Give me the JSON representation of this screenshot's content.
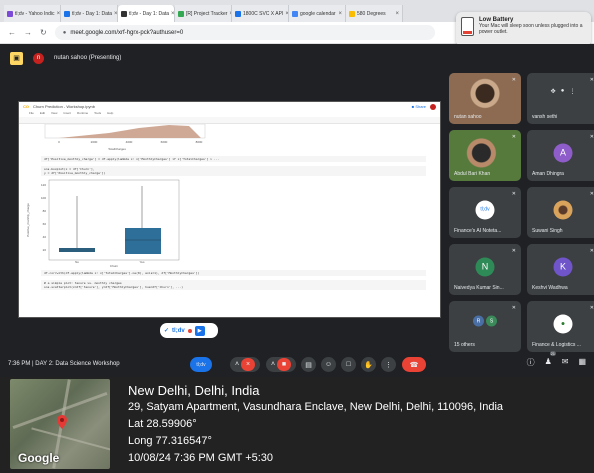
{
  "browser": {
    "tabs": [
      {
        "label": "tl;dv - Yahoo Indic",
        "color": "#7b4bd8"
      },
      {
        "label": "tl;dv - Day 1: Data",
        "color": "#1a73e8"
      },
      {
        "label": "tl;dv - Day 1: Data",
        "color": "#333333"
      },
      {
        "label": "[R] Project Tracker",
        "color": "#34a853"
      },
      {
        "label": "1800C SVC X API",
        "color": "#1a73e8"
      },
      {
        "label": "google calendar",
        "color": "#4285f4"
      },
      {
        "label": "580 Degrees",
        "color": "#fbbc04"
      }
    ],
    "url": "meet.google.com/xrf-hgrx-pck?authuser=0"
  },
  "notification": {
    "title": "Low Battery",
    "body": "Your Mac will sleep soon unless plugged into a power outlet."
  },
  "meet": {
    "presenter": "nutan sahoo (Presenting)",
    "presenter_initial": "n",
    "chip_label": "tl;dv",
    "meeting_info": "7:36 PM  |  DAY 2: Data Science Workshop",
    "participants_count": "21",
    "participants": [
      {
        "name": "nutan sahoo",
        "initial": "",
        "color": "#6b4f3a"
      },
      {
        "name": "vansh sethi",
        "initial": "",
        "color": "#3c4043"
      },
      {
        "name": "Abdul Bari Khan",
        "initial": "",
        "color": "#556b3a"
      },
      {
        "name": "Aman Dhingra",
        "initial": "A",
        "color": "#8e5dc9"
      },
      {
        "name": "Finance's AI Noteta...",
        "initial": "tl;dv",
        "color": "#ffffff"
      },
      {
        "name": "Suwani Singh",
        "initial": "",
        "color": "#d9a35c"
      },
      {
        "name": "Naivedya Kumar Sin...",
        "initial": "N",
        "color": "#2e8b57"
      },
      {
        "name": "Keshvi Wadhwa",
        "initial": "K",
        "color": "#6f55c9"
      },
      {
        "name": "15 others",
        "initial": "",
        "color": "#3c4043"
      },
      {
        "name": "Finance & Logistics ...",
        "initial": "",
        "color": "#3c4043"
      }
    ],
    "others_avatars": [
      "R",
      "S"
    ],
    "controls": {
      "record_label": "tl;dv"
    }
  },
  "notebook": {
    "title": "Churn Prediction - Workshop.ipynb",
    "menu": [
      "File",
      "Edit",
      "View",
      "Insert",
      "Runtime",
      "Tools",
      "Help"
    ],
    "code_line_1": "df['Positive_monthly_charge'] = df.apply(lambda x: x['MonthlyCharges'] if x['TotalCharges'] > ...",
    "code_line_2": "sns.boxplot(x = df['Churn'],",
    "code_line_3": "            y = df['Positive_monthly_charge'])",
    "code_line_4": "df.corrwith(df.apply(lambda x: x['TotalCharges'].ne(0), axis=1), df['MonthlyCharges'])",
    "code_line_5": "# a simple plot: tenure vs. monthly charges",
    "code_line_6": "sns.scatterplot(x=df['tenure'], y=df['MonthlyCharges'], hue=df['Churn'], ...)",
    "ylabel": "Positive_monthly_charge",
    "xlabel": "Churn",
    "xlabel_top": "TotalCharges",
    "top_ticks": [
      "0",
      "2000",
      "4000",
      "6000",
      "8000"
    ],
    "box_ticks": [
      "No",
      "Yes"
    ],
    "y_ticks": [
      "120",
      "100",
      "80",
      "60",
      "40",
      "20"
    ]
  },
  "geo": {
    "line1": "New Delhi, Delhi, India",
    "line2": "29, Satyam Apartment, Vasundhara Enclave, New Delhi, Delhi, 110096, India",
    "line3": "Lat 28.59906°",
    "line4": "Long 77.316547°",
    "line5": "10/08/24 7:36 PM GMT +5:30",
    "brand": "Google"
  },
  "colors": {
    "meet_bg": "#202124",
    "tile_bg": "#3c4043",
    "hangup": "#ea4335",
    "accent": "#1a73e8"
  }
}
